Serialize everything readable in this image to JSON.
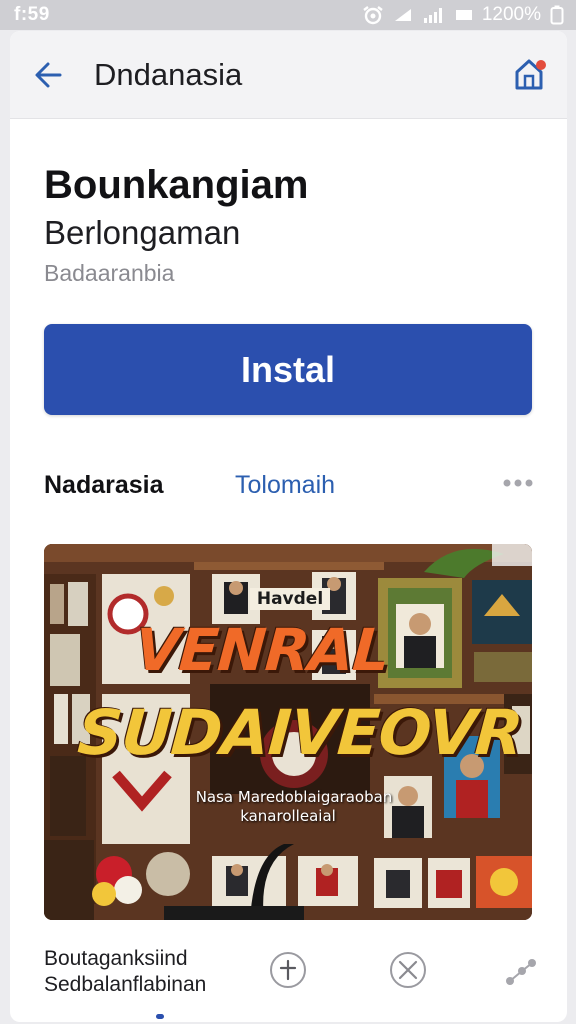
{
  "status_bar": {
    "time": "f:59",
    "battery_text": "1200%"
  },
  "app_bar": {
    "title": "Dndanasia"
  },
  "app": {
    "title": "Bounkangiam",
    "developer": "Berlongaman",
    "category": "Badaaranbia"
  },
  "install_button": {
    "label": "Instal"
  },
  "tabs": {
    "primary": "Nadarasia",
    "secondary": "Tolomaih"
  },
  "screenshot": {
    "sign": "Havdel",
    "banner_line_1": "VENRAL",
    "banner_line_2": "SUDAIVEOVR",
    "caption_line_1": "Nasa Maredoblaigaraoban",
    "caption_line_2": "kanarolleaial"
  },
  "bottom": {
    "title_line_1": "Boutaganksiind",
    "title_line_2": "Sedbalanflabinan"
  },
  "colors": {
    "accent": "#2b4fae",
    "link": "#2c5fb0",
    "badge": "#e34c3c"
  },
  "icons": {
    "back": "arrow-left-icon",
    "home": "home-icon",
    "more": "more-horizontal-icon",
    "add": "add-icon",
    "close": "close-circle-icon",
    "share": "share-icon"
  }
}
